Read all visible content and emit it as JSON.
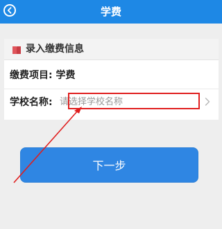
{
  "header": {
    "title": "学费"
  },
  "form": {
    "section_title": "录入缴费信息",
    "fee_item_label": "缴费项目:",
    "fee_item_value": "学费",
    "school_label": "学校名称:",
    "school_placeholder": "请选择学校名称"
  },
  "actions": {
    "next_label": "下一步"
  },
  "colors": {
    "brand_blue": "#1e88e5",
    "button_blue": "#2f86e3",
    "annotation_red": "#e01e1e"
  },
  "icons": {
    "back": "back-arrow-icon",
    "section": "book-icon",
    "chevron": "chevron-right-icon"
  }
}
